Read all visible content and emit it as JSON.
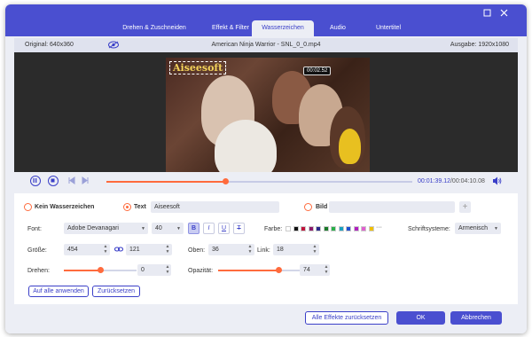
{
  "tabs": [
    "Drehen & Zuschneiden",
    "Effekt & Filter",
    "Wasserzeichen",
    "Audio",
    "Untertitel"
  ],
  "active_tab": "Wasserzeichen",
  "window_controls": {
    "maximize_icon": "maximize-icon",
    "close_icon": "close-icon"
  },
  "info": {
    "original": "Original: 640x360",
    "filename": "American Ninja Warrior - SNL_0_0.mp4",
    "output": "Ausgabe: 1920x1080"
  },
  "preview": {
    "watermark_text": "Aiseesoft",
    "timestamp_badge": "00:02.52"
  },
  "playback": {
    "current": "00:01:39.12",
    "total": "/00:04:10.08",
    "progress": 0.39
  },
  "watermark": {
    "none_label": "Kein Wasserzeichen",
    "text_label": "Text",
    "text_value": "Aiseesoft",
    "image_label": "Bild",
    "selected": "text"
  },
  "font": {
    "label": "Font:",
    "family": "Adobe Devanagari",
    "size": "40",
    "style_buttons": [
      "B",
      "I",
      "U",
      "T"
    ],
    "color_label": "Farbe:",
    "colors": [
      "#ffffff",
      "#111111",
      "#c0143c",
      "#8b1a6b",
      "#2a2a8a",
      "#1a7a2a",
      "#2ab04a",
      "#1aa0c0",
      "#2050d0",
      "#b020c0",
      "#e060d0",
      "#f0c000"
    ],
    "more": "···",
    "script_label": "Schriftsysteme:",
    "script_value": "Armenisch"
  },
  "size": {
    "label": "Größe:",
    "width": "454",
    "height": "121",
    "link_icon": "link-icon"
  },
  "position": {
    "top_label": "Oben:",
    "top": "36",
    "left_label": "Link:",
    "left": "18"
  },
  "rotate": {
    "label": "Drehen:",
    "value": "0",
    "level": 0.5
  },
  "opacity": {
    "label": "Opazität:",
    "value": "74",
    "level": 0.74
  },
  "buttons": {
    "apply_all": "Auf alle anwenden",
    "reset": "Zurücksetzen",
    "reset_all": "Alle Effekte zurücksetzen",
    "ok": "OK",
    "cancel": "Abbrechen"
  }
}
